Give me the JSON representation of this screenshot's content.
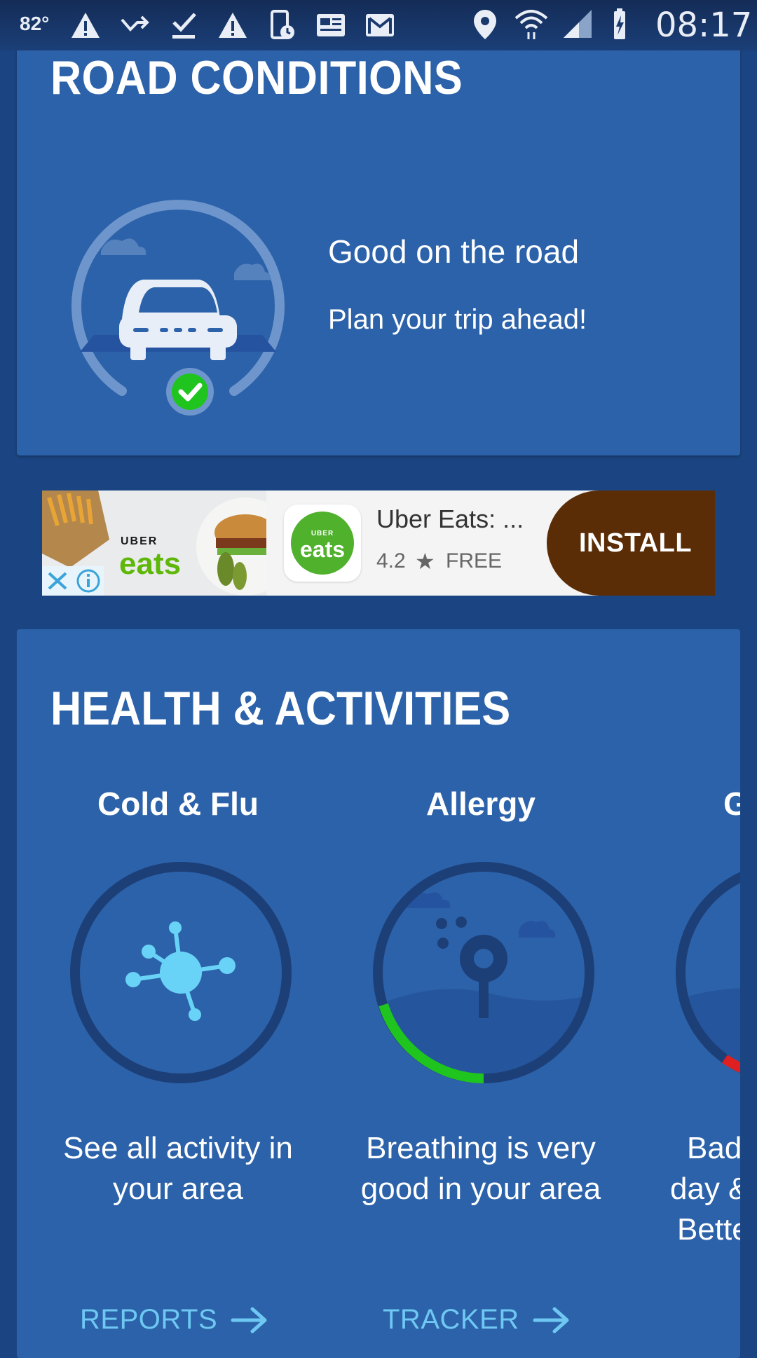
{
  "status_bar": {
    "temperature": "82°",
    "time": "08:17",
    "left_icons": [
      "warning-icon",
      "missed-call-icon",
      "download-done-icon",
      "warning-icon",
      "phone-alarm-icon",
      "news-icon",
      "gmail-icon"
    ],
    "right_icons": [
      "location-icon",
      "wifi-icon",
      "cell-signal-icon",
      "battery-charging-icon"
    ]
  },
  "road_conditions": {
    "title": "ROAD CONDITIONS",
    "status": "Good on the road",
    "subtitle": "Plan your trip ahead!",
    "status_color": "#1fc41f"
  },
  "ad": {
    "image_brand_small": "UBER",
    "image_brand_big": "eats",
    "app_icon_small": "UBER",
    "app_icon_big": "eats",
    "app_name": "Uber Eats: ...",
    "rating": "4.2",
    "price": "FREE",
    "install_label": "INSTALL",
    "install_color": "#5a2d07"
  },
  "health": {
    "title": "HEALTH & ACTIVITIES",
    "tiles": [
      {
        "label": "Cold & Flu",
        "description_line1": "See all activity in",
        "description_line2": "your area",
        "link": "REPORTS",
        "icon": "virus-icon"
      },
      {
        "label": "Allergy",
        "description_line1": "Breathing is very",
        "description_line2": "good in your area",
        "link": "TRACKER",
        "icon": "pollen-tree-icon",
        "gauge_color": "#1fc41f"
      },
      {
        "label": "G",
        "description_line1": "Bad w",
        "description_line2": "day &",
        "description_line3": "Bette",
        "description_line4": "w",
        "gauge_color": "#e02020"
      }
    ]
  },
  "colors": {
    "background": "#1b4582",
    "card": "#2c62a9",
    "link": "#6ec8f2"
  }
}
